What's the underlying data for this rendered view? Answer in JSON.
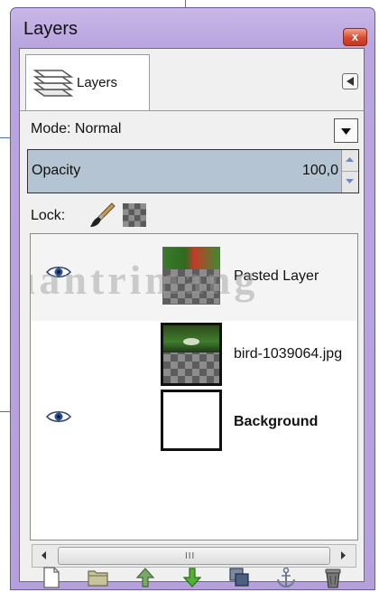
{
  "window": {
    "title": "Layers",
    "close_label": "x"
  },
  "tab": {
    "label": "Layers"
  },
  "mode": {
    "label": "Mode:",
    "value": "Normal"
  },
  "opacity": {
    "label": "Opacity",
    "value": "100,0"
  },
  "lock": {
    "label": "Lock:"
  },
  "layers": [
    {
      "name": "Pasted Layer",
      "visible": true
    },
    {
      "name": "bird-1039064.jpg",
      "visible": false
    },
    {
      "name": "Background",
      "visible": true
    }
  ],
  "watermark": "Quantrimang",
  "scrollbar": {
    "grip": "III"
  },
  "icons": {
    "tab": "layers-stack-icon",
    "tab_menu": "tab-menu-arrow-icon",
    "eye": "eye-icon",
    "lock_pixels": "paintbrush-icon",
    "lock_alpha": "checkerboard-icon",
    "toolbar": [
      "new-layer-icon",
      "folder-icon",
      "raise-layer-icon",
      "lower-layer-icon",
      "duplicate-layer-icon",
      "anchor-icon",
      "delete-icon"
    ]
  },
  "colors": {
    "opacity_bg": "#b4c4d2",
    "window_frame": "#b9a6df",
    "close_button": "#d9492f"
  }
}
